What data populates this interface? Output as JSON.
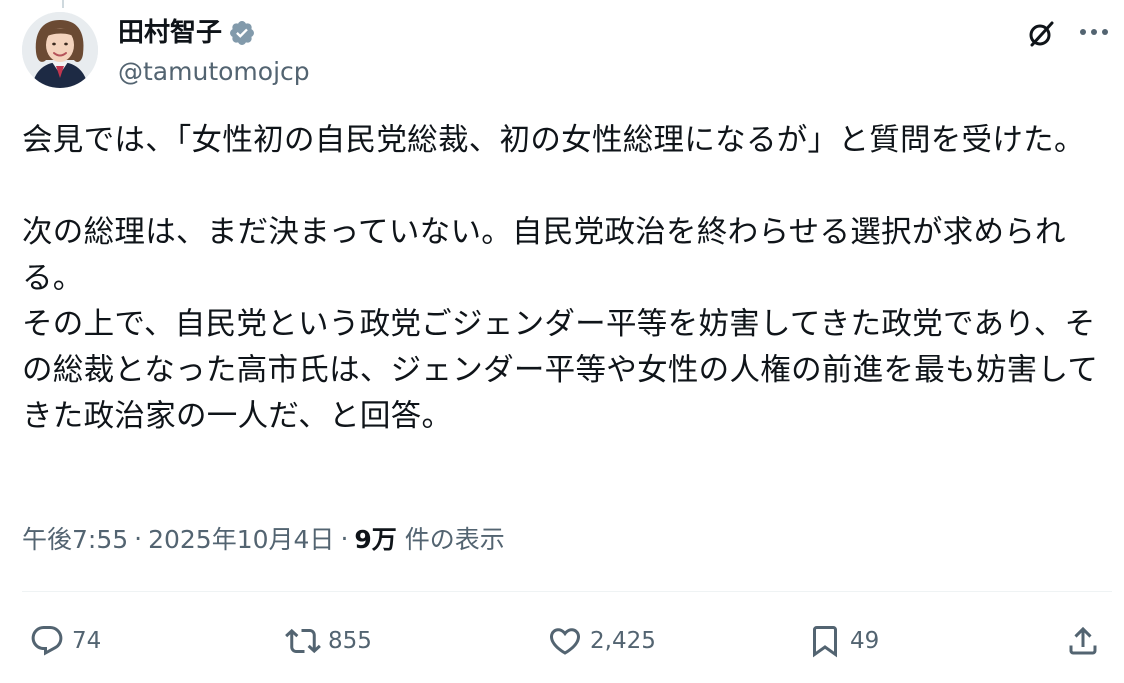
{
  "post": {
    "author": {
      "display_name": "田村智子",
      "handle": "@tamutomojcp",
      "verified": true,
      "avatar_icon": "avatar-photo"
    },
    "header_icons": [
      "grok-icon",
      "more-icon"
    ],
    "text": "会見では、「女性初の自民党総裁、初の女性総理になるが」と質問を受けた。\n\n次の総理は、まだ決まっていない。自民党政治を終わらせる選択が求められる。\nその上で、自民党という政党ごジェンダー平等を妨害してきた政党であり、その総裁となった高市氏は、ジェンダー平等や女性の人権の前進を最も妨害してきた政治家の一人だ、と回答。",
    "meta": {
      "time": "午後7:55",
      "separator": "·",
      "date": "2025年10月4日",
      "views_count": "9万",
      "views_label": "件の表示"
    },
    "actions": {
      "reply": {
        "icon": "reply-icon",
        "count": "74"
      },
      "repost": {
        "icon": "repost-icon",
        "count": "855"
      },
      "like": {
        "icon": "heart-icon",
        "count": "2,425"
      },
      "bookmark": {
        "icon": "bookmark-icon",
        "count": "49"
      },
      "share": {
        "icon": "share-icon"
      }
    }
  },
  "colors": {
    "text_primary": "#0f1419",
    "text_secondary": "#536471",
    "divider": "#eff3f4",
    "verified_badge": "#829aab"
  }
}
